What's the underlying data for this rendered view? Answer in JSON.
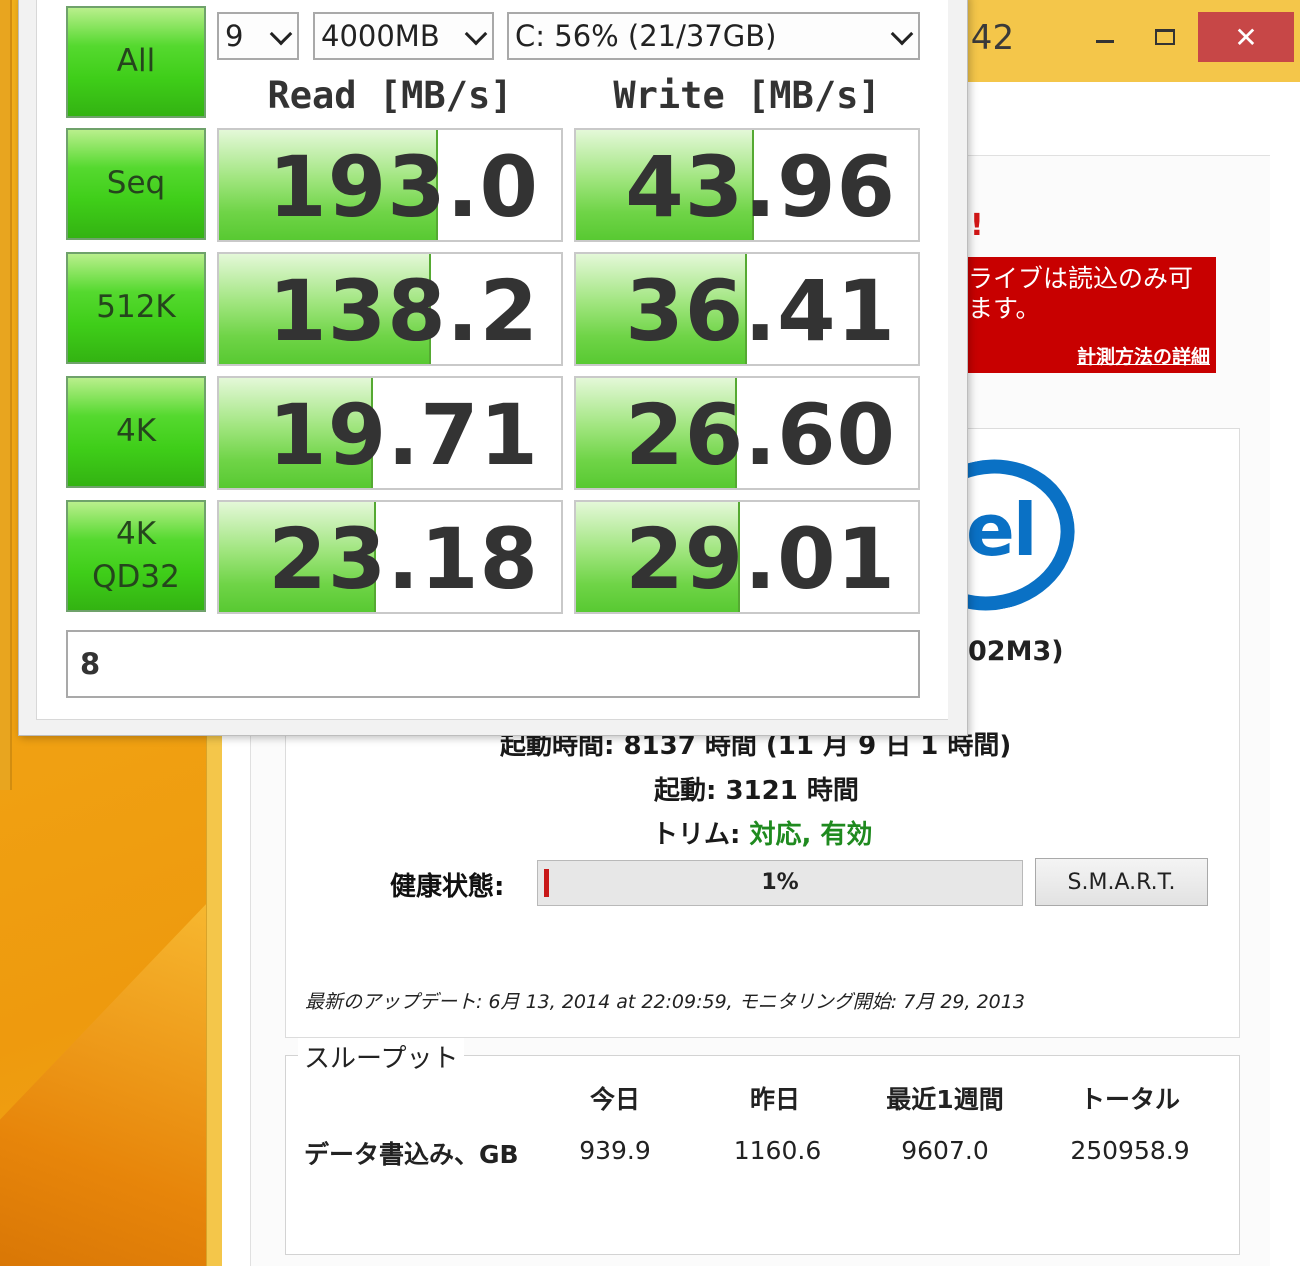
{
  "back_window": {
    "title_fragment": ".42",
    "alert": {
      "mark": "!",
      "line1": "ライブは読込のみ可",
      "line2": "ます。",
      "link": "計測方法の詳細"
    },
    "logo_fragment": "el",
    "model_fragment": "02M3)",
    "power_on_line": "起動時間: 8137 時間 (11 月 9 日 1 時間)",
    "startup_label": "起動:",
    "startup_value": "3121 時間",
    "trim_label": "トリム:",
    "trim_value": "対応, 有効",
    "health_label": "健康状態:",
    "health_value": "1%",
    "health_fraction": 0.01,
    "smart_button": "S.M.A.R.T.",
    "update_line": "最新のアップデート: 6月 13, 2014 at 22:09:59, モニタリング開始: 7月 29, 2013",
    "throughput": {
      "legend": "スループット",
      "headers": [
        "今日",
        "昨日",
        "最近1週間",
        "トータル"
      ],
      "row_label": "データ書込み、GB",
      "values": [
        "939.9",
        "1160.6",
        "9607.0",
        "250958.9"
      ]
    },
    "colors": {
      "alert_bg": "#c80000",
      "ok_green": "#1f8a1f",
      "logo_blue": "#0a71c5"
    }
  },
  "cdm": {
    "all_button": "All",
    "count_select": "9",
    "size_select": "4000MB",
    "drive_select": "C: 56% (21/37GB)",
    "read_header": "Read [MB/s]",
    "write_header": "Write [MB/s]",
    "rows": [
      {
        "label1": "Seq",
        "label2": "",
        "read": "193.0",
        "write": "43.96",
        "read_fill": 0.64,
        "write_fill": 0.52
      },
      {
        "label1": "512K",
        "label2": "",
        "read": "138.2",
        "write": "36.41",
        "read_fill": 0.62,
        "write_fill": 0.5
      },
      {
        "label1": "4K",
        "label2": "",
        "read": "19.71",
        "write": "26.60",
        "read_fill": 0.45,
        "write_fill": 0.47
      },
      {
        "label1": "4K",
        "label2": "QD32",
        "read": "23.18",
        "write": "29.01",
        "read_fill": 0.46,
        "write_fill": 0.48
      }
    ],
    "comment": "8",
    "colors": {
      "button_green": "#3fce19",
      "bar_green": "#6fd447"
    }
  }
}
